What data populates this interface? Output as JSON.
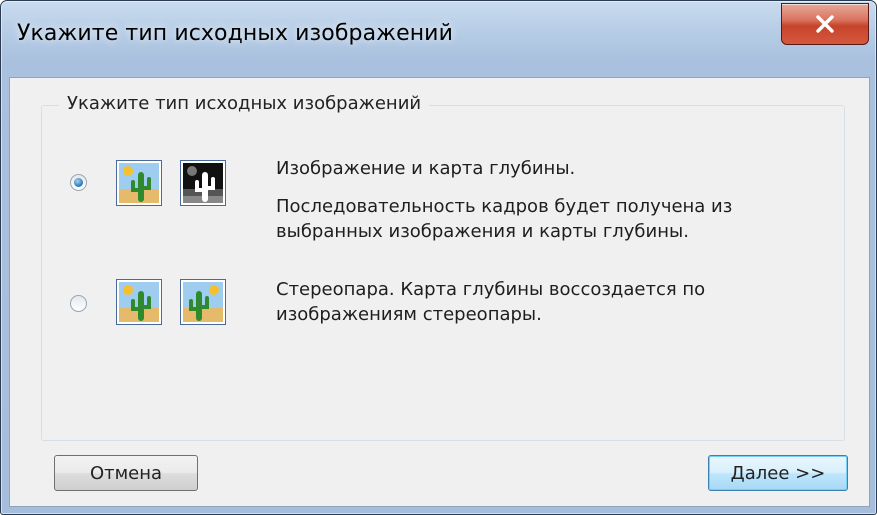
{
  "window": {
    "title": "Укажите тип исходных изображений"
  },
  "group": {
    "label": "Укажите тип исходных изображений"
  },
  "options": [
    {
      "selected": true,
      "icons": [
        "cactus-photo-icon",
        "cactus-depth-map-icon"
      ],
      "line1": "Изображение и карта глубины.",
      "line2": "Последовательность кадров будет получена из",
      "line3": "выбранных изображения и карты глубины."
    },
    {
      "selected": false,
      "icons": [
        "cactus-left-icon",
        "cactus-right-icon"
      ],
      "line1": "Стереопара. Карта глубины воссоздается по",
      "line2": "изображениям стереопары."
    }
  ],
  "buttons": {
    "cancel": "Отмена",
    "next": "Далее >>"
  },
  "colors": {
    "title_bg": "#b7cde6",
    "client_bg": "#f0f0f0",
    "close_red": "#c7432b",
    "default_button_border": "#3c7fb1"
  }
}
